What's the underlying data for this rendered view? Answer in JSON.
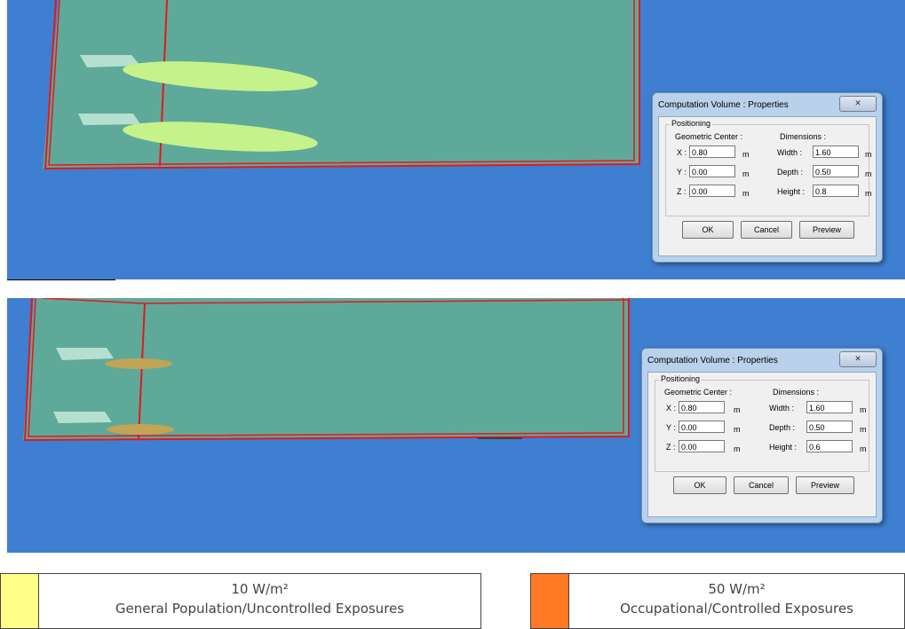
{
  "dialogs": [
    {
      "title": "Computation Volume : Properties",
      "close_icon": "close-icon",
      "group_label": "Positioning",
      "center_header": "Geometric Center :",
      "dims_header": "Dimensions :",
      "x_label": "X :",
      "y_label": "Y :",
      "z_label": "Z :",
      "x_value": "0.80",
      "y_value": "0.00",
      "z_value": "0.00",
      "width_label": "Width :",
      "depth_label": "Depth :",
      "height_label": "Height :",
      "width_value": "1.60",
      "depth_value": "0.50",
      "height_value": "0.8",
      "unit": "m",
      "ok_label": "OK",
      "cancel_label": "Cancel",
      "preview_label": "Preview"
    },
    {
      "title": "Computation Volume : Properties",
      "close_icon": "close-icon",
      "group_label": "Positioning",
      "center_header": "Geometric Center :",
      "dims_header": "Dimensions :",
      "x_label": "X :",
      "y_label": "Y :",
      "z_label": "Z :",
      "x_value": "0.80",
      "y_value": "0.00",
      "z_value": "0.00",
      "width_label": "Width :",
      "depth_label": "Depth :",
      "height_label": "Height :",
      "width_value": "1.60",
      "depth_value": "0.50",
      "height_value": "0.6",
      "unit": "m",
      "ok_label": "OK",
      "cancel_label": "Cancel",
      "preview_label": "Preview"
    }
  ],
  "legend": [
    {
      "value": "10 W/m²",
      "label": "General Population/Uncontrolled Exposures",
      "color": "#ffff88"
    },
    {
      "value": "50 W/m²",
      "label": "Occupational/Controlled Exposures",
      "color": "#ff7a22"
    }
  ],
  "colors": {
    "background": "#3f7fd1",
    "ground_plane": "#5fa99a",
    "volume_outline": "#e8161b",
    "plume_top": "#c6f28c",
    "plume_bottom": "#c2a455"
  }
}
